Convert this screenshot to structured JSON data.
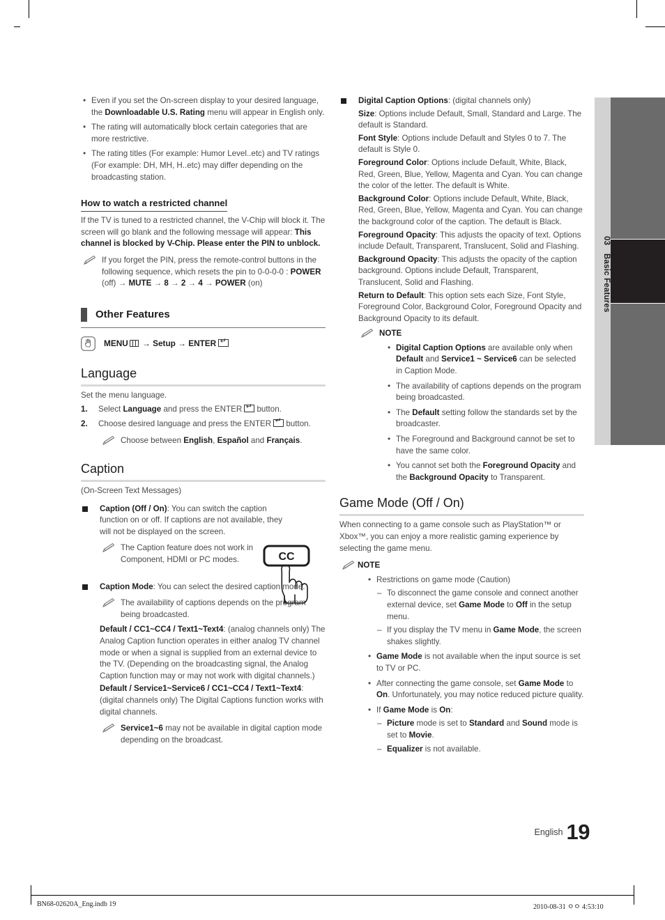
{
  "page": {
    "number": "19",
    "language_label": "English",
    "tab_number": "03",
    "tab_title": "Basic Features"
  },
  "footer": {
    "file": "BN68-02620A_Eng.indb   19",
    "timestamp": "2010-08-31   ㅇㅇ 4:53:10"
  },
  "left_column": {
    "top_bullets": [
      "Even if you set the On-screen display to your desired language, the <b>Downloadable U.S. Rating</b> menu will appear in English only.",
      "The rating will automatically block certain categories that are more restrictive.",
      "The rating titles (For example: Humor Level..etc) and TV ratings (For example: DH, MH, H..etc) may differ depending on the broadcasting station."
    ],
    "restricted": {
      "heading": "How to watch a restricted channel",
      "paragraph": "If the TV is tuned to a restricted channel, the V-Chip will block it. The screen will go blank and the following message will appear: <b>This channel is blocked by V-Chip. Please enter the PIN to unblock.</b>",
      "note": "If you forget the PIN, press the remote-control buttons in the following sequence, which resets the pin to 0-0-0-0 : <b>POWER</b> (off) → <b>MUTE</b> → <b>8</b> → <b>2</b> → <b>4</b> → <b>POWER</b> (on)"
    },
    "other_features": {
      "band_title": "Other Features",
      "menu_path_prefix": "MENU",
      "menu_path_middle": "→ Setup → ENTER"
    },
    "language_section": {
      "title": "Language",
      "intro": "Set the menu language.",
      "steps": [
        {
          "num": "1.",
          "text_before": "Select <b>Language</b> and press the ENTER",
          "text_after": " button."
        },
        {
          "num": "2.",
          "text_before": "Choose desired language and press the ENTER",
          "text_after": " button."
        }
      ],
      "note": "Choose between <b>English</b>, <b>Español</b> and <b>Français</b>."
    },
    "caption_section": {
      "title": "Caption",
      "subtitle": "(On-Screen Text Messages)",
      "illustration_label": "CC",
      "items": [
        {
          "text": "<b>Caption (Off / On)</b>: You can switch the caption function on or off. If captions are not available, they will not be displayed on the screen.",
          "note": "The Caption feature does not work in Component, HDMI or PC modes."
        },
        {
          "text": "<b>Caption Mode</b>: You can select the desired caption mode.",
          "note": "The availability of captions depends on the program being broadcasted."
        }
      ],
      "paragraphs": [
        "<b>Default / CC1~CC4 / Text1~Text4</b>: (analog channels only) The Analog Caption function operates in either analog TV channel mode or when a signal is supplied from an external device to the TV. (Depending on the broadcasting signal, the Analog Caption function may or may not work with digital channels.)",
        "<b>Default / Service1~Service6 / CC1~CC4 / Text1~Text4</b>: (digital channels only) The Digital Captions function works with digital channels."
      ],
      "final_note": "<b>Service1~6</b> may not be available in digital caption mode depending on the broadcast."
    }
  },
  "right_column": {
    "digital_caption_options": {
      "title": "<b>Digital Caption Options</b>: (digital channels only)",
      "options": [
        "<b>Size</b>: Options include Default, Small, Standard and Large. The default is Standard.",
        "<b>Font Style</b>: Options include Default and Styles 0 to 7. The default is Style 0.",
        "<b>Foreground Color</b>: Options include Default, White, Black, Red, Green, Blue, Yellow, Magenta and Cyan. You can change the color of the letter. The default is White.",
        "<b>Background Color</b>: Options include Default, White, Black, Red, Green, Blue, Yellow, Magenta and Cyan. You can change the background color of the caption. The default is Black.",
        "<b>Foreground Opacity</b>: This adjusts the opacity of text. Options include Default, Transparent, Translucent, Solid and Flashing.",
        "<b>Background Opacity</b>: This adjusts the opacity of the caption background. Options include Default, Transparent, Translucent, Solid and Flashing.",
        "<b>Return to Default</b>: This option sets each Size, Font Style, Foreground Color, Background Color, Foreground Opacity and Background Opacity to its default."
      ],
      "note_heading": "NOTE",
      "notes": [
        "<b>Digital Caption Options</b> are available only when <b>Default</b> and <b>Service1 ~ Service6</b> can be selected in Caption Mode.",
        "The availability of captions depends on the program being broadcasted.",
        "The <b>Default</b> setting follow the standards set by the broadcaster.",
        "The Foreground and Background cannot be set to have the same color.",
        "You cannot set both the <b>Foreground Opacity</b> and the <b>Background Opacity</b> to Transparent."
      ]
    },
    "game_mode": {
      "title": "Game Mode (Off / On)",
      "intro": "When connecting to a game console such as PlayStation™ or Xbox™, you can enjoy a more realistic gaming experience by selecting the game menu.",
      "note_heading": "NOTE",
      "notes": [
        {
          "text": "Restrictions on game mode (Caution)",
          "subs": [
            "To disconnect the game console and connect another external device, set <b>Game Mode</b> to <b>Off</b> in the setup menu.",
            "If you display the TV menu in <b>Game Mode</b>, the screen shakes slightly."
          ]
        },
        {
          "text": "<b>Game Mode</b> is not available when the input source is set to TV or PC.",
          "subs": []
        },
        {
          "text": "After connecting the game console, set <b>Game Mode</b> to <b>On</b>. Unfortunately, you may notice reduced picture quality.",
          "subs": []
        },
        {
          "text": "If <b>Game Mode</b> is <b>On</b>:",
          "subs": [
            "<b>Picture</b> mode is set to <b>Standard</b> and <b>Sound</b> mode is set to <b>Movie</b>.",
            "<b>Equalizer</b> is not available."
          ]
        }
      ]
    }
  }
}
